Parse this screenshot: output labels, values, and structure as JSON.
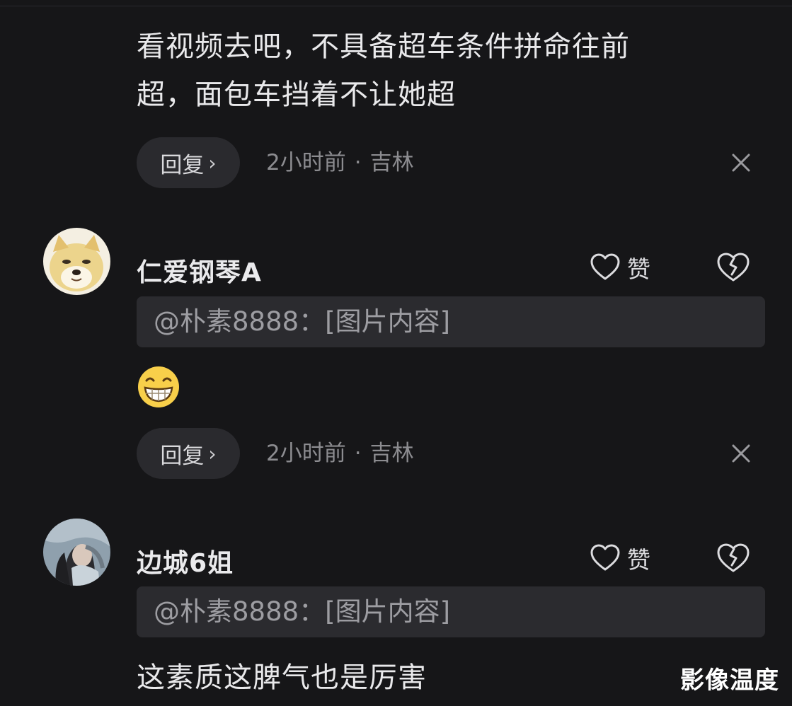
{
  "top_comment": {
    "text_line1": "看视频去吧，不具备超车条件拼命往前",
    "text_line2": "超，面包车挡着不让她超",
    "reply_label": "回复",
    "time": "2小时前",
    "location": "吉林",
    "separator": "·"
  },
  "comments": [
    {
      "username": "仁爱钢琴A",
      "like_label": "赞",
      "quote": "@朴素8888：[图片内容]",
      "body_emoji": "grinning-emoji",
      "reply_label": "回复",
      "time": "2小时前",
      "location": "吉林",
      "separator": "·"
    },
    {
      "username": "边城6姐",
      "like_label": "赞",
      "quote": "@朴素8888：[图片内容]",
      "body": "这素质这脾气也是厉害"
    }
  ],
  "watermark": "影像温度",
  "colors": {
    "background": "#161618",
    "pill": "#2a2a2e",
    "quote_bg": "#2b2b2f",
    "muted": "#8c8c90"
  }
}
